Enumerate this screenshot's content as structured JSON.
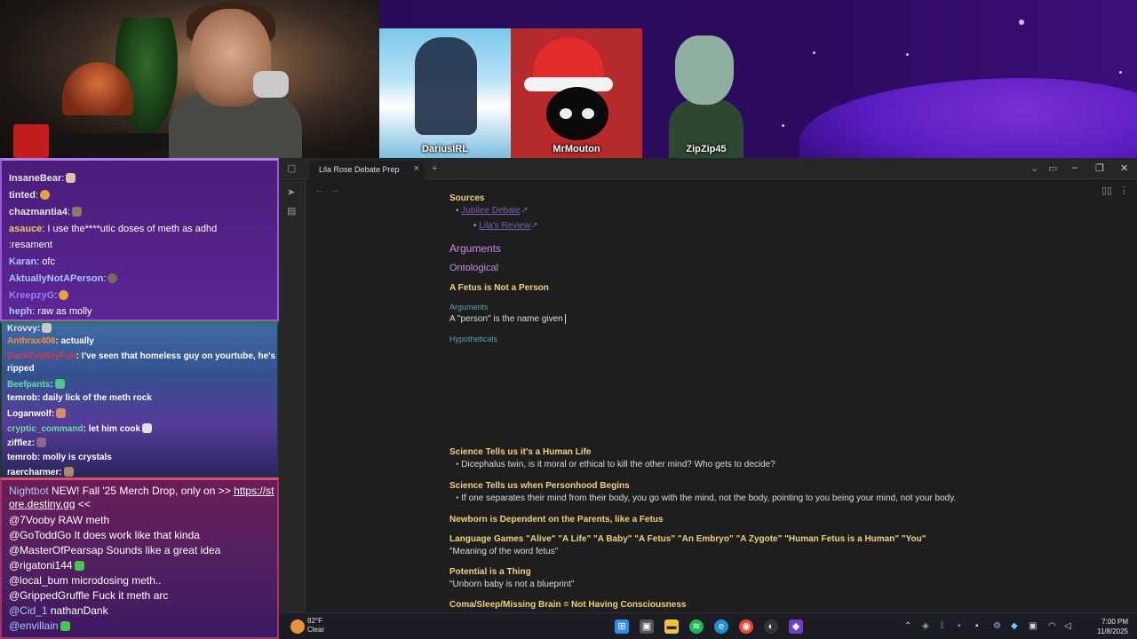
{
  "stream": {
    "participants": [
      "DariusIRL",
      "MrMouton",
      "ZipZip45"
    ]
  },
  "chat_top": [
    {
      "user": "InsaneBear",
      "text": "",
      "color": "#e6e6e6"
    },
    {
      "user": "tinted",
      "text": "",
      "color": "#e6e6e6"
    },
    {
      "user": "chazmantia4",
      "text": "",
      "color": "#e6e6e6"
    },
    {
      "user": "asauce",
      "text": " I use the****utic doses of meth as adhd",
      "color": "#f2c94c"
    },
    {
      "user": "",
      "text": ":resament",
      "color": "#e6e6e6"
    },
    {
      "user": "Karan",
      "text": " ofc",
      "color": "#a7c7ff"
    },
    {
      "user": "AktuallyNotAPerson",
      "text": "",
      "color": "#a7c7ff"
    },
    {
      "user": "KreepzyG",
      "text": "",
      "color": "#9c7bff"
    },
    {
      "user": "heph",
      "text": " raw as molly",
      "color": "#a7c7ff"
    }
  ],
  "chat_mid": [
    {
      "user": "Krovvy",
      "text": "",
      "color": "#e6e6e6"
    },
    {
      "user": "Anthrax406",
      "text": " actually",
      "color": "#ff8c3a"
    },
    {
      "user": "DuckFestinyFun",
      "text": " I've seen that homeless guy on yourtube, he's",
      "color": "#e8304a"
    },
    {
      "user": "",
      "text": "ripped",
      "color": "#ffffff"
    },
    {
      "user": "Beefpants",
      "text": "",
      "color": "#5ee4a0"
    },
    {
      "user": "temrob",
      "text": " daily lick of the meth rock",
      "color": "#ffffff"
    },
    {
      "user": "Loganwolf",
      "text": "",
      "color": "#ffffff"
    },
    {
      "user": "cryptic_command",
      "text": " let him cook",
      "color": "#5ee4a0"
    },
    {
      "user": "zifflez",
      "text": "",
      "color": "#ffffff"
    },
    {
      "user": "temrob",
      "text": " molly is crystals",
      "color": "#ffffff"
    },
    {
      "user": "raercharmer",
      "text": "",
      "color": "#ffffff"
    }
  ],
  "chat_bot": {
    "nightbot_user": "Nightbot",
    "nightbot_text": " NEW! Fall '25 Merch Drop, only on >> ",
    "nightbot_link": "https://store.destiny.gg",
    "nightbot_tail": " <<",
    "lines": [
      {
        "user": "@7Vooby",
        "text": " RAW meth",
        "color": "#ffffff"
      },
      {
        "user": "@GoToddGo",
        "text": " It does work like that kinda",
        "color": "#ffffff"
      },
      {
        "user": "@MasterOfPearsap",
        "text": " Sounds like a great idea",
        "color": "#ffffff"
      },
      {
        "user": "@rigatoni144",
        "text": "",
        "color": "#ffffff"
      },
      {
        "user": "@local_bum",
        "text": " microdosing meth..",
        "color": "#ffffff"
      },
      {
        "user": "@GrippedGruffle",
        "text": " Fuck it meth arc",
        "color": "#ffffff"
      },
      {
        "user": "@Cid_1",
        "text": " nathanDank",
        "color": "#a7c7ff"
      },
      {
        "user": "@envillain",
        "text": "",
        "color": "#ffffff"
      }
    ]
  },
  "app": {
    "tab_title": "Lila Rose Debate Prep",
    "doc": {
      "sources_heading": "Sources",
      "link1": "Jubilee Debate",
      "link2": "Lila's Review",
      "h_arguments": "Arguments",
      "h_ontological": "Ontological",
      "h_fetus_not_person": "A Fetus is Not a Person",
      "sub_arguments": "Arguments",
      "person_line": "A \"person\" is the name given",
      "sub_hypotheticals": "Hypotheticals",
      "h_science_human": "Science Tells us it's a Human Life",
      "b_dicephalus": "Dicephalus twin, is it moral or ethical to kill the other mind? Who gets to decide?",
      "h_science_person": "Science Tells us when Personhood Begins",
      "b_separates": "If one separates their mind from their body, you go with the mind, not the body, pointing to you being your mind, not your body.",
      "h_newborn": "Newborn is Dependent on the Parents, like a Fetus",
      "h_language": "Language Games \"Alive\" \"A Life\" \"A Baby\" \"A Fetus\" \"An Embryo\" \"A Zygote\" \"Human Fetus is a Human\" \"You\"",
      "l_meaning": "\"Meaning of the word fetus\"",
      "h_potential": "Potential is a Thing",
      "l_unborn": "\"Unborn baby is not a blueprint\"",
      "h_coma": "Coma/Sleep/Missing Brain = Not Having Consciousness"
    }
  },
  "taskbar": {
    "temp": "82°F",
    "weather": "Clear",
    "time": "7:00 PM",
    "date": "11/8/2025"
  },
  "colors": {
    "accent_purple": "#c88be6",
    "heading_yellow": "#f1d17a",
    "hint_teal": "#5aa0b4"
  }
}
